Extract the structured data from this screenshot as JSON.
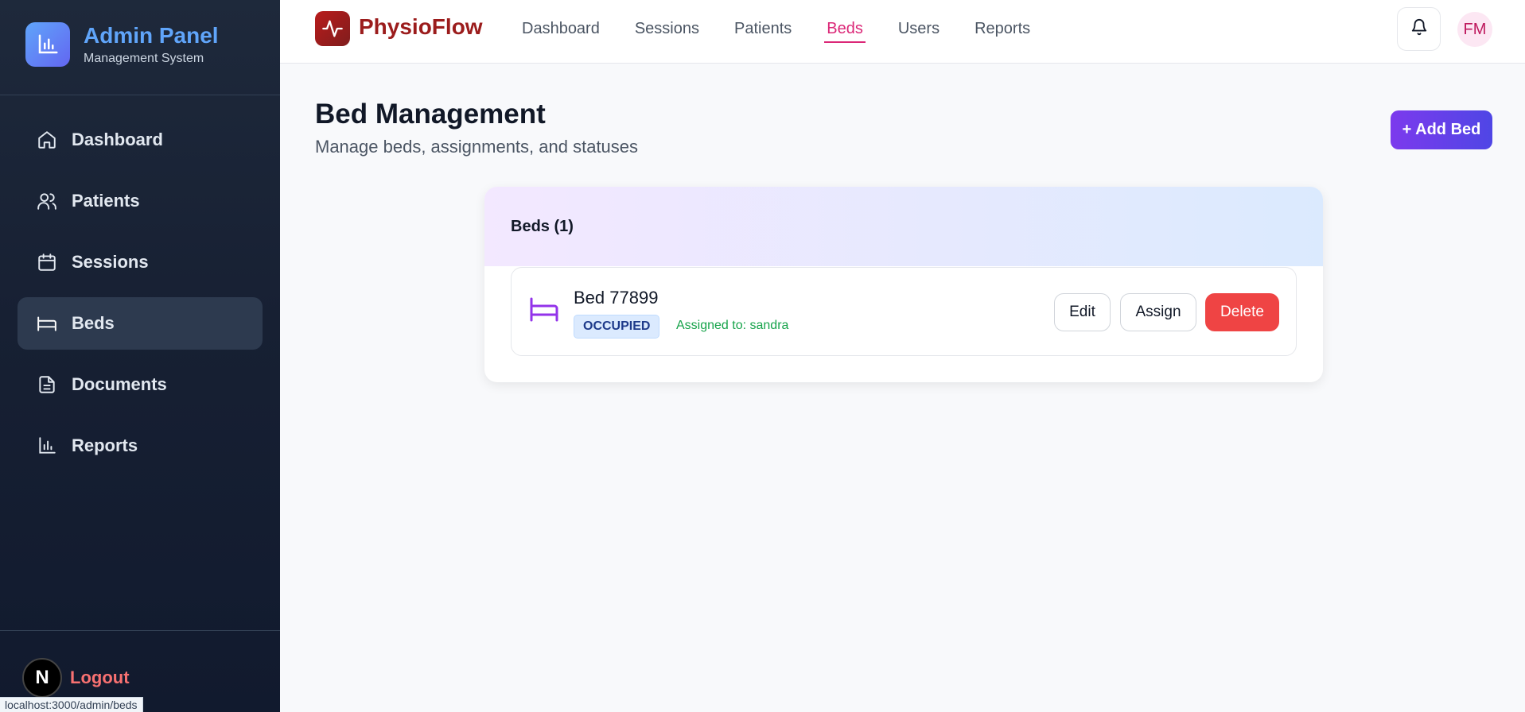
{
  "sidebar": {
    "brand_title": "Admin Panel",
    "brand_subtitle": "Management System",
    "items": [
      {
        "label": "Dashboard",
        "icon": "home-icon"
      },
      {
        "label": "Patients",
        "icon": "users-icon"
      },
      {
        "label": "Sessions",
        "icon": "calendar-icon"
      },
      {
        "label": "Beds",
        "icon": "bed-icon",
        "active": true
      },
      {
        "label": "Documents",
        "icon": "document-icon"
      },
      {
        "label": "Reports",
        "icon": "bar-chart-icon"
      }
    ],
    "logout_badge": "N",
    "logout_label": "Logout",
    "status_url": "localhost:3000/admin/beds"
  },
  "header": {
    "app_name": "PhysioFlow",
    "nav": [
      "Dashboard",
      "Sessions",
      "Patients",
      "Beds",
      "Users",
      "Reports"
    ],
    "active_nav": "Beds",
    "avatar_initials": "FM"
  },
  "main": {
    "title": "Bed Management",
    "subtitle": "Manage beds, assignments, and statuses",
    "add_button": "+ Add Bed",
    "list_title": "Beds (1)",
    "beds": [
      {
        "name": "Bed 77899",
        "status": "OCCUPIED",
        "assigned": "Assigned to: sandra",
        "actions": {
          "edit": "Edit",
          "assign": "Assign",
          "delete": "Delete"
        }
      }
    ]
  },
  "colors": {
    "sidebar_bg": "#1e293b",
    "brand_accent": "#60a5fa",
    "app_brand": "#9b1c1c",
    "active_nav": "#db2777",
    "primary_button": "#7c3aed",
    "danger": "#ef4444",
    "status_badge": "#dbeafe",
    "assigned_text": "#16a34a"
  }
}
